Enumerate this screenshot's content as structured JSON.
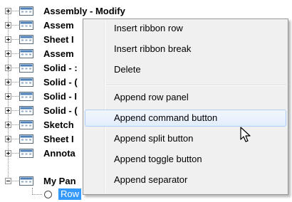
{
  "tree": {
    "nodes": [
      {
        "label": "Assembly - Modify",
        "expander": "plus"
      },
      {
        "label": "Assem",
        "expander": "plus"
      },
      {
        "label": "Sheet I",
        "expander": "plus"
      },
      {
        "label": "Assem",
        "expander": "plus"
      },
      {
        "label": "Solid - :",
        "expander": "plus"
      },
      {
        "label": "Solid - (",
        "expander": "plus"
      },
      {
        "label": "Solid - I",
        "expander": "plus"
      },
      {
        "label": "Solid - (",
        "expander": "plus"
      },
      {
        "label": "Sketch",
        "expander": "plus"
      },
      {
        "label": "Sheet I",
        "expander": "plus"
      },
      {
        "label": "Annota",
        "expander": "plus"
      },
      {
        "label": "My Pan",
        "expander": "minus"
      }
    ],
    "child": {
      "label": "Row"
    }
  },
  "context_menu": {
    "items": [
      {
        "label": "Insert ribbon row"
      },
      {
        "label": "Insert ribbon break"
      },
      {
        "label": "Delete"
      },
      {
        "label": "Append row panel"
      },
      {
        "label": "Append command button",
        "highlighted": true
      },
      {
        "label": "Append split button"
      },
      {
        "label": "Append toggle button"
      },
      {
        "label": "Append separator"
      }
    ]
  },
  "colors": {
    "selection": "#3399ff",
    "menu_background": "#f0f0f0",
    "menu_hover_border": "#aecff7"
  },
  "icons": {
    "panel": "ribbon-panel-icon",
    "row": "radio-circle-icon",
    "cursor": "mouse-pointer-icon"
  }
}
